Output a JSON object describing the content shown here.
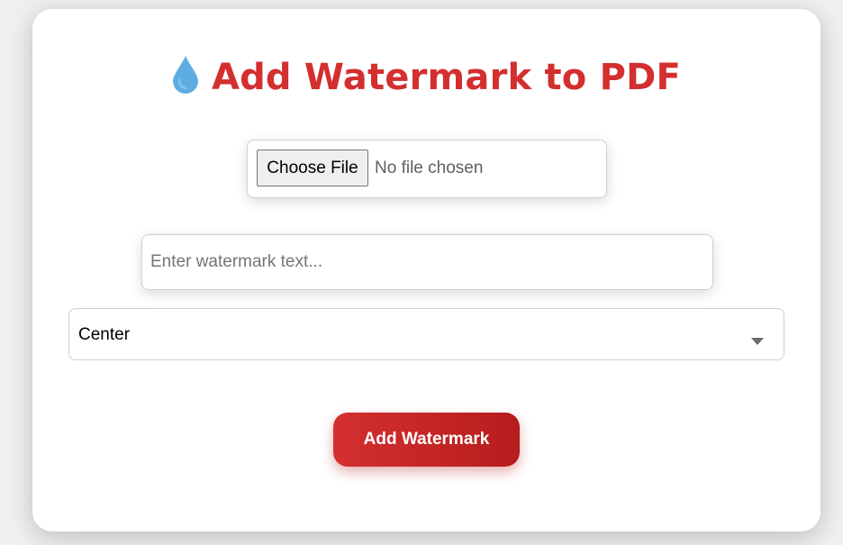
{
  "header": {
    "title": "Add Watermark to PDF",
    "icon": "droplet-icon"
  },
  "file_input": {
    "button_label": "Choose File",
    "status": "No file chosen"
  },
  "watermark_text": {
    "placeholder": "Enter watermark text...",
    "value": ""
  },
  "position_select": {
    "selected": "Center"
  },
  "submit": {
    "label": "Add Watermark"
  },
  "colors": {
    "accent": "#d32f2f",
    "button_gradient_end": "#b71c1c",
    "icon_blue": "#5dade2"
  }
}
